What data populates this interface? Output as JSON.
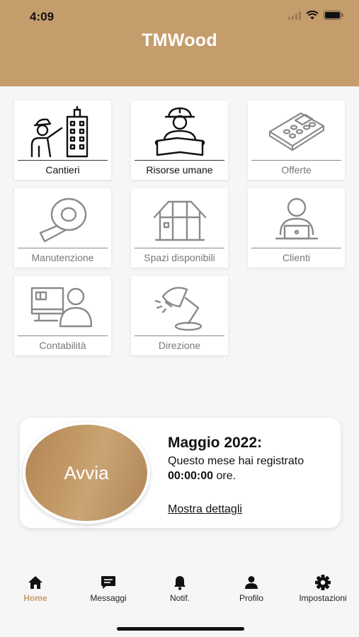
{
  "status": {
    "time": "4:09"
  },
  "app": {
    "title": "TMWood"
  },
  "tiles": [
    {
      "label": "Cantieri",
      "icon": "worker-building-icon",
      "enabled": true
    },
    {
      "label": "Risorse umane",
      "icon": "worker-blueprint-icon",
      "enabled": true
    },
    {
      "label": "Offerte",
      "icon": "calculator-icon",
      "enabled": false
    },
    {
      "label": "Manutenzione",
      "icon": "tape-roll-icon",
      "enabled": false
    },
    {
      "label": "Spazi disponibili",
      "icon": "shed-icon",
      "enabled": false
    },
    {
      "label": "Clienti",
      "icon": "client-laptop-icon",
      "enabled": false
    },
    {
      "label": "Contabilità",
      "icon": "accountant-icon",
      "enabled": false
    },
    {
      "label": "Direzione",
      "icon": "desk-lamp-icon",
      "enabled": false
    }
  ],
  "timer": {
    "button_label": "Avvia",
    "month": "Maggio 2022:",
    "description": "Questo mese hai registrato",
    "hours": "00:00:00",
    "hours_suffix": " ore.",
    "details_link": "Mostra dettagli"
  },
  "tabs": [
    {
      "label": "Home",
      "icon": "home-icon",
      "active": true
    },
    {
      "label": "Messaggi",
      "icon": "message-icon",
      "active": false
    },
    {
      "label": "Notif.",
      "icon": "bell-icon",
      "active": false
    },
    {
      "label": "Profilo",
      "icon": "person-icon",
      "active": false
    },
    {
      "label": "Impostazioni",
      "icon": "gear-icon",
      "active": false
    }
  ],
  "colors": {
    "accent": "#c59d6c",
    "inactive_text": "#777777"
  }
}
